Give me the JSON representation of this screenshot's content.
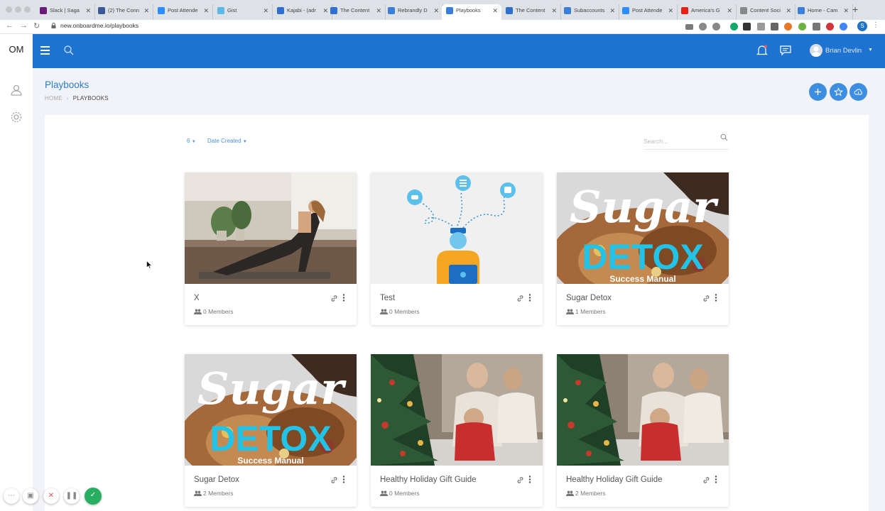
{
  "browser": {
    "tabs": [
      {
        "title": "Slack | Saga",
        "color": "#6a1b7a"
      },
      {
        "title": "(2) The Conn",
        "color": "#3b5998"
      },
      {
        "title": "Post Attende",
        "color": "#2d8cff"
      },
      {
        "title": "Gist",
        "color": "#5cb8e6"
      },
      {
        "title": "Kajabi - (adr",
        "color": "#2f6fd0"
      },
      {
        "title": "The Content",
        "color": "#2f6fd0"
      },
      {
        "title": "Rebrandly D",
        "color": "#3c7fd8"
      },
      {
        "title": "Playbooks",
        "color": "#3c7fd8"
      },
      {
        "title": "The Content",
        "color": "#2f6fd0"
      },
      {
        "title": "Subaccounts",
        "color": "#3c7fd8"
      },
      {
        "title": "Post Attende",
        "color": "#2d8cff"
      },
      {
        "title": "America's G",
        "color": "#e62117"
      },
      {
        "title": "Content Soci",
        "color": "#888888"
      },
      {
        "title": "Home - Cam",
        "color": "#3c7fd8"
      }
    ],
    "url": "new.onboardme.io/playbooks",
    "profile_initial": "S"
  },
  "app": {
    "logo": "OM",
    "user_name": "Brian Devlin",
    "page_title": "Playbooks",
    "breadcrumb": {
      "home": "HOME",
      "current": "PLAYBOOKS"
    },
    "filters": {
      "count": "6",
      "sort": "Date Created"
    },
    "search_placeholder": "Search..."
  },
  "cards": [
    {
      "name": "X",
      "members": "0 Members",
      "image": "yoga"
    },
    {
      "name": "Test",
      "members": "0 Members",
      "image": "illustration"
    },
    {
      "name": "Sugar Detox",
      "members": "1 Members",
      "image": "sugar-detox"
    },
    {
      "name": "Sugar Detox",
      "members": "2 Members",
      "image": "sugar-detox"
    },
    {
      "name": "Healthy Holiday Gift Guide",
      "members": "0 Members",
      "image": "holiday"
    },
    {
      "name": "Healthy Holiday Gift Guide",
      "members": "2 Members",
      "image": "holiday"
    }
  ],
  "sugar_detox_art": {
    "script": "Sugar",
    "headline": "DETOX",
    "sub": "Success Manual"
  },
  "colors": {
    "primary": "#1e73d0",
    "accent": "#3d8ee0",
    "detox": "#22c3e6",
    "success": "#27ae60"
  }
}
